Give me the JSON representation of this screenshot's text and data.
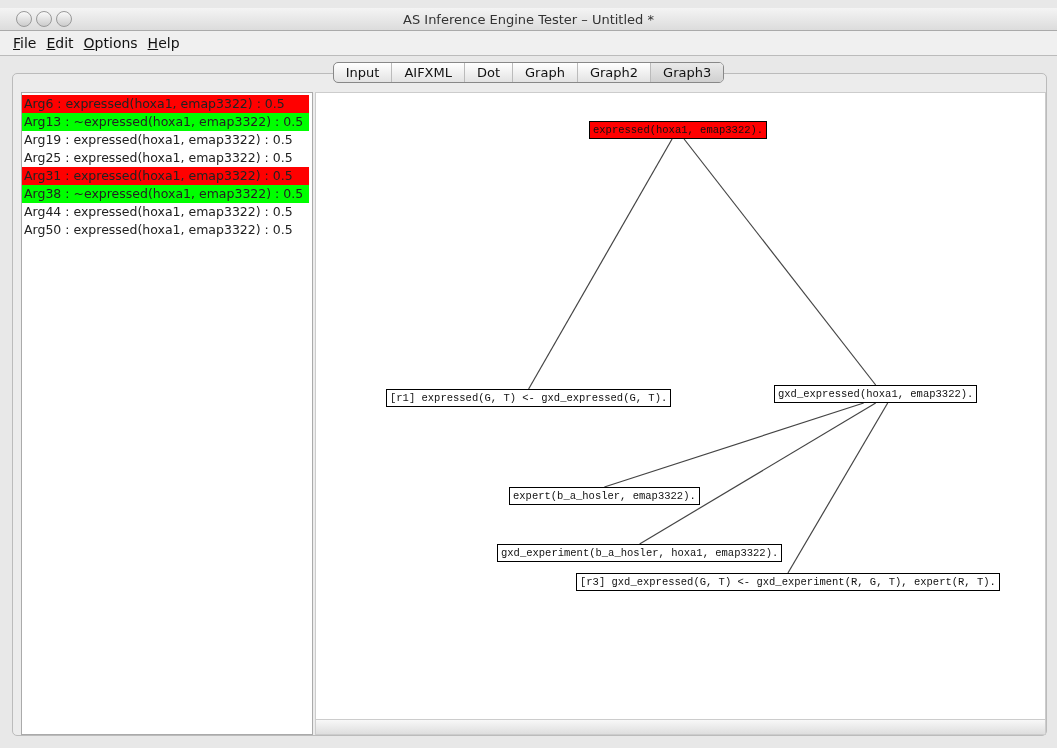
{
  "window": {
    "title": "AS Inference Engine Tester – Untitled *"
  },
  "menu": [
    {
      "label": "File"
    },
    {
      "label": "Edit"
    },
    {
      "label": "Options"
    },
    {
      "label": "Help"
    }
  ],
  "tabs": [
    {
      "label": "Input",
      "selected": false
    },
    {
      "label": "AIFXML",
      "selected": false
    },
    {
      "label": "Dot",
      "selected": false
    },
    {
      "label": "Graph",
      "selected": false
    },
    {
      "label": "Graph2",
      "selected": false
    },
    {
      "label": "Graph3",
      "selected": true
    }
  ],
  "arguments": [
    {
      "text": "Arg6 : expressed(hoxa1, emap3322) : 0.5",
      "color": "#ff0000"
    },
    {
      "text": "Arg13 : ~expressed(hoxa1, emap3322) : 0.5",
      "color": "#00ff00"
    },
    {
      "text": "Arg19 : expressed(hoxa1, emap3322) : 0.5",
      "color": "#ffffff"
    },
    {
      "text": "Arg25 : expressed(hoxa1, emap3322) : 0.5",
      "color": "#ffffff"
    },
    {
      "text": "Arg31 : expressed(hoxa1, emap3322) : 0.5",
      "color": "#ff0000"
    },
    {
      "text": "Arg38 : ~expressed(hoxa1, emap3322) : 0.5",
      "color": "#00ff00"
    },
    {
      "text": "Arg44 : expressed(hoxa1, emap3322) : 0.5",
      "color": "#ffffff"
    },
    {
      "text": "Arg50 : expressed(hoxa1, emap3322) : 0.5",
      "color": "#ffffff"
    }
  ],
  "graph": {
    "root": {
      "label": "expressed(hoxa1, emap3322).",
      "color": "#ff0000",
      "children": [
        {
          "label": "[r1] expressed(G, T) <- gxd_expressed(G, T).",
          "color": "#ffffff"
        },
        {
          "label": "gxd_expressed(hoxa1, emap3322).",
          "color": "#ffffff",
          "children": [
            {
              "label": "expert(b_a_hosler, emap3322).",
              "color": "#ffffff"
            },
            {
              "label": "gxd_experiment(b_a_hosler, hoxa1, emap3322).",
              "color": "#ffffff"
            },
            {
              "label": "[r3] gxd_expressed(G, T) <- gxd_experiment(R, G, T), expert(R, T).",
              "color": "#ffffff"
            }
          ]
        }
      ]
    }
  }
}
